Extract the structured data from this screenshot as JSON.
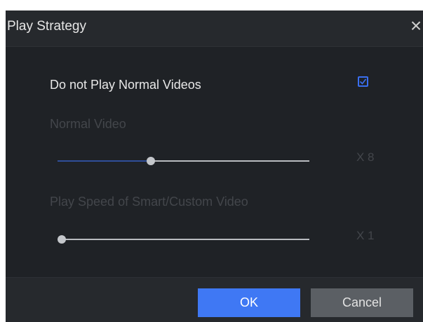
{
  "dialog": {
    "title": "Play Strategy",
    "close_glyph": "×",
    "close_icon": "close-icon"
  },
  "option": {
    "label": "Do not Play Normal Videos",
    "checked": true,
    "check_color": "#3a6ff0"
  },
  "normal_video": {
    "label": "Normal Video",
    "value_label": "X 8",
    "slider_level": 0.37
  },
  "smart_video": {
    "label": "Play Speed of Smart/Custom Video",
    "value_label": "X 1",
    "slider_level": 0.0
  },
  "buttons": {
    "ok": "OK",
    "cancel": "Cancel"
  },
  "colors": {
    "dialog_bg": "#1f2226",
    "accent": "#3f78f4",
    "slider_fill": "#2f4f9a"
  }
}
